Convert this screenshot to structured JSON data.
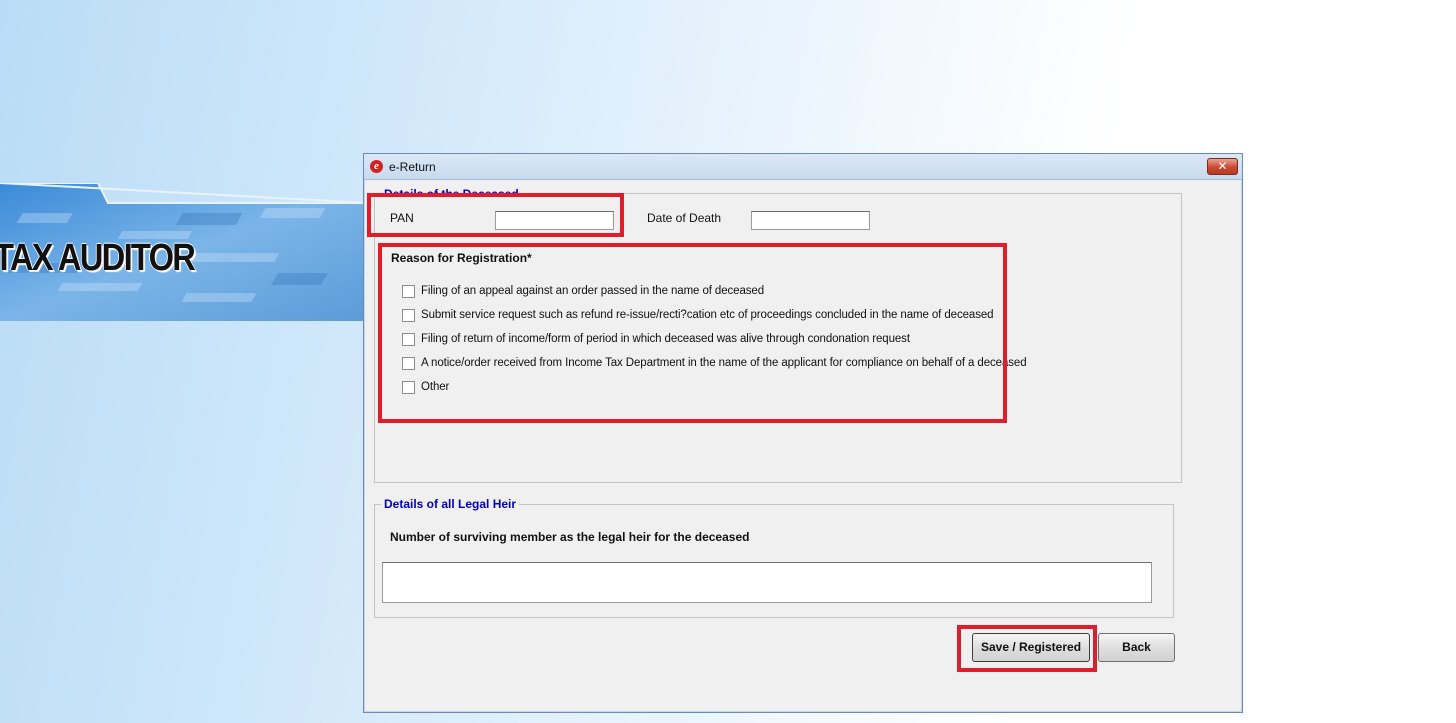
{
  "background": {
    "banner_title": "TAX AUDITOR"
  },
  "window": {
    "title": "e-Return",
    "app_icon": "e-return-logo-icon",
    "close_icon": "close-icon",
    "close_glyph": "✕"
  },
  "deceased": {
    "legend": "Details of the Deceased",
    "pan_label": "PAN",
    "pan_value": "",
    "dod_label": "Date of Death",
    "dod_value": "",
    "reason_title": "Reason for Registration*",
    "reasons": [
      "Filing of an appeal against an order passed in the name of deceased",
      "Submit service request such as refund re-issue/recti?cation etc of proceedings concluded in the name of deceased",
      "Filing of return of income/form of period in which deceased was alive through condonation request",
      "A notice/order received from Income Tax Department in the name of the applicant for compliance on behalf of a deceased",
      "Other"
    ]
  },
  "legal_heir": {
    "legend": "Details of all Legal Heir",
    "count_label": "Number of surviving member as the legal heir for the deceased",
    "count_value": ""
  },
  "buttons": {
    "save": "Save / Registered",
    "back": "Back"
  },
  "colors": {
    "legend": "#0000c8",
    "highlight": "#e01e2b",
    "close": "#c94a33"
  }
}
